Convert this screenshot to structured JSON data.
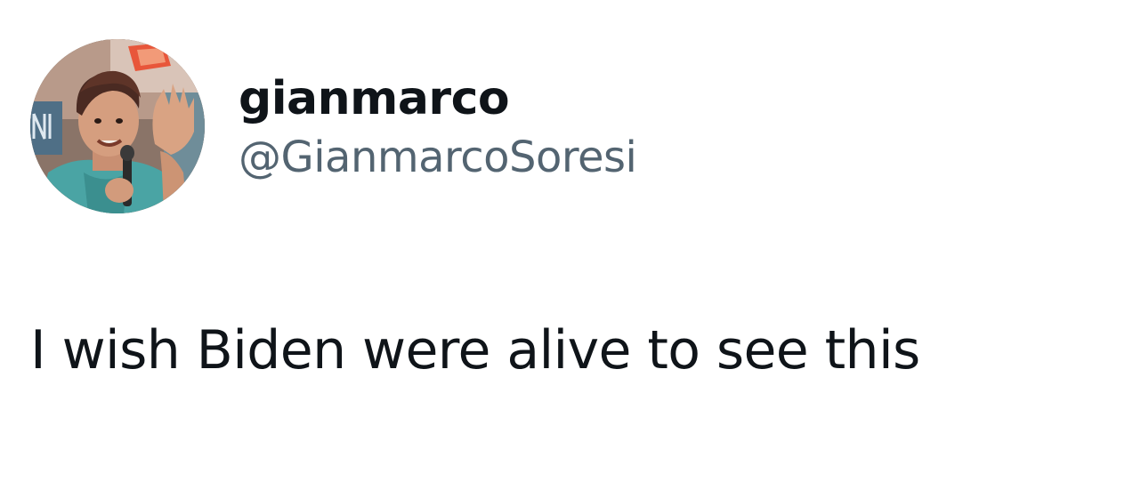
{
  "tweet": {
    "author": {
      "display_name": "gianmarco",
      "handle": "@GianmarcoSoresi",
      "avatar_icon": "profile-photo"
    },
    "text": "I wish Biden were alive to see this"
  },
  "colors": {
    "background": "#ffffff",
    "primary_text": "#0f1419",
    "secondary_text": "#536471"
  }
}
